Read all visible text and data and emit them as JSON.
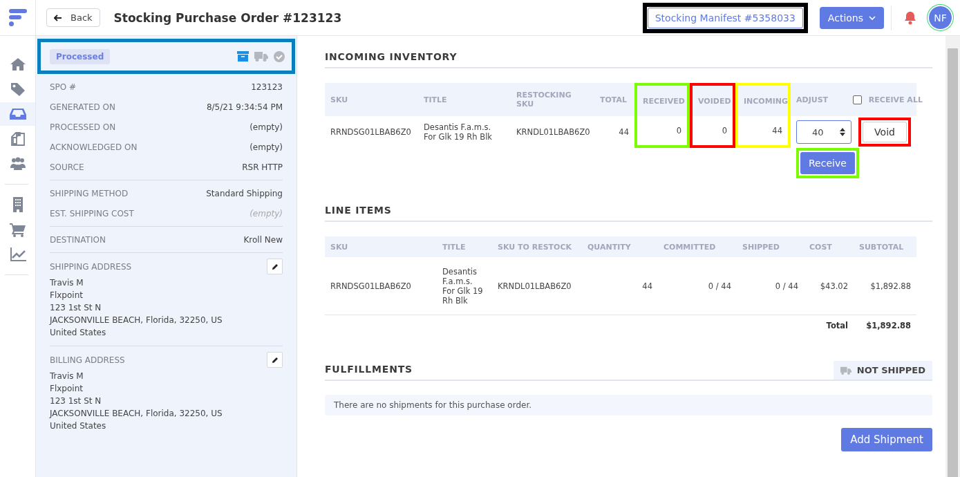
{
  "header": {
    "back_button": "Back",
    "title": "Stocking Purchase Order #123123",
    "manifest_button": {
      "label": "Stocking Manifest #5358033",
      "color": "#000000"
    },
    "actions_button": "Actions",
    "avatar": "NF"
  },
  "nav": [
    [
      {
        "kind": "home",
        "selected": false
      },
      {
        "kind": "tag",
        "selected": false
      },
      {
        "kind": "inbox",
        "selected": true
      },
      {
        "kind": "copy",
        "selected": false
      },
      {
        "kind": "users",
        "selected": false
      }
    ],
    [
      {
        "kind": "building",
        "selected": false
      },
      {
        "kind": "cart",
        "selected": false
      },
      {
        "kind": "chart",
        "selected": false
      }
    ]
  ],
  "status_panel": {
    "badge": "Processed",
    "color": "#0a7fc0",
    "steps": [
      {
        "kind": "archive",
        "done": true
      },
      {
        "kind": "truck",
        "done": false
      },
      {
        "kind": "check",
        "done": false
      }
    ]
  },
  "detail_groups": [
    [
      {
        "label": "SPO #",
        "value": "123123",
        "muted": false
      },
      {
        "label": "GENERATED ON",
        "value": "8/5/21 9:34:54 PM",
        "muted": false
      },
      {
        "label": "PROCESSED ON",
        "value": "(empty)",
        "muted": false
      },
      {
        "label": "ACKNOWLEDGED ON",
        "value": "(empty)",
        "muted": false
      },
      {
        "label": "SOURCE",
        "value": "RSR HTTP",
        "muted": false
      }
    ],
    [
      {
        "label": "SHIPPING METHOD",
        "value": "Standard Shipping",
        "muted": false
      },
      {
        "label": "EST. SHIPPING COST",
        "value": "(empty)",
        "muted": true
      }
    ],
    [
      {
        "label": "DESTINATION",
        "value": "Kroll New",
        "muted": false
      }
    ]
  ],
  "addresses": [
    {
      "label": "SHIPPING ADDRESS",
      "lines": [
        "Travis M",
        "Flxpoint",
        "123 1st St N",
        "JACKSONVILLE BEACH, Florida, 32250, US",
        "United States"
      ]
    },
    {
      "label": "BILLING ADDRESS",
      "lines": [
        "Travis M",
        "Flxpoint",
        "123 1st St N",
        "JACKSONVILLE BEACH, Florida, 32250, US",
        "United States"
      ]
    }
  ],
  "incoming_inventory": {
    "title": "INCOMING INVENTORY",
    "columns": [
      {
        "label": "SKU"
      },
      {
        "label": "TITLE"
      },
      {
        "label": "RESTOCKING SKU"
      },
      {
        "label": "TOTAL"
      },
      {
        "label": "RECEIVED",
        "color": "#7cfc00"
      },
      {
        "label": "VOIDED",
        "color": "#ff0000"
      },
      {
        "label": "INCOMING",
        "color": "#ffff00"
      },
      {
        "label": "ADJUST"
      }
    ],
    "receive_all": {
      "label": "RECEIVE ALL",
      "checked": false
    },
    "rows": [
      {
        "cells": [
          "RRNDSG01LBAB6Z0",
          "Desantis F.a.m.s. For Glk 19 Rh Blk",
          "KRNDL01LBAB6Z0",
          "44",
          "0",
          "0",
          "44"
        ],
        "adjust": "40",
        "void_button": {
          "label": "Void",
          "color": "#ff0000"
        },
        "receive_button": {
          "label": "Receive",
          "color": "#7cfc00"
        }
      }
    ]
  },
  "line_items": {
    "title": "LINE ITEMS",
    "columns": [
      "SKU",
      "TITLE",
      "SKU TO RESTOCK",
      "QUANTITY",
      "COMMITTED",
      "SHIPPED",
      "COST",
      "SUBTOTAL"
    ],
    "rows": [
      [
        "RRNDSG01LBAB6Z0",
        "Desantis F.a.m.s. For Glk 19 Rh Blk",
        "KRNDL01LBAB6Z0",
        "44",
        "0 / 44",
        "0 / 44",
        "$43.02",
        "$1,892.88"
      ]
    ],
    "total_label": "Total",
    "total_value": "$1,892.88"
  },
  "fulfillments": {
    "title": "FULFILLMENTS",
    "status": "NOT SHIPPED",
    "empty_message": "There are no shipments for this purchase order.",
    "add_button": "Add Shipment"
  }
}
